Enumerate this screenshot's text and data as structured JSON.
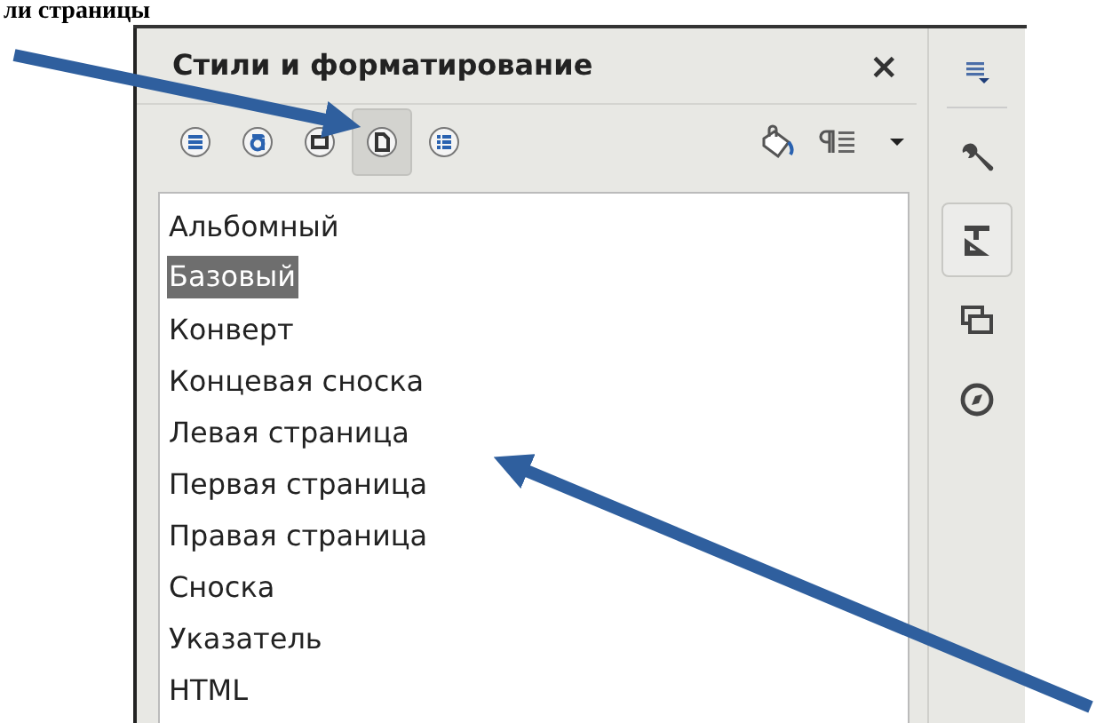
{
  "caption": "ли страницы",
  "panel": {
    "title": "Стили и форматирование",
    "close": "×",
    "style_families": [
      {
        "kind": "paragraph",
        "selected": false
      },
      {
        "kind": "character",
        "selected": false
      },
      {
        "kind": "frame",
        "selected": false
      },
      {
        "kind": "page",
        "selected": true
      },
      {
        "kind": "list",
        "selected": false
      }
    ],
    "styles": [
      {
        "label": "Альбомный",
        "selected": false
      },
      {
        "label": "Базовый",
        "selected": true
      },
      {
        "label": "Конверт",
        "selected": false
      },
      {
        "label": "Концевая сноска",
        "selected": false
      },
      {
        "label": "Левая страница",
        "selected": false
      },
      {
        "label": "Первая страница",
        "selected": false
      },
      {
        "label": "Правая страница",
        "selected": false
      },
      {
        "label": "Сноска",
        "selected": false
      },
      {
        "label": "Указатель",
        "selected": false
      },
      {
        "label": "HTML",
        "selected": false
      }
    ]
  },
  "sidebar": {
    "tabs": [
      {
        "kind": "properties",
        "selected": false
      },
      {
        "kind": "styles",
        "selected": true
      },
      {
        "kind": "gallery",
        "selected": false
      },
      {
        "kind": "navigator",
        "selected": false
      }
    ]
  }
}
